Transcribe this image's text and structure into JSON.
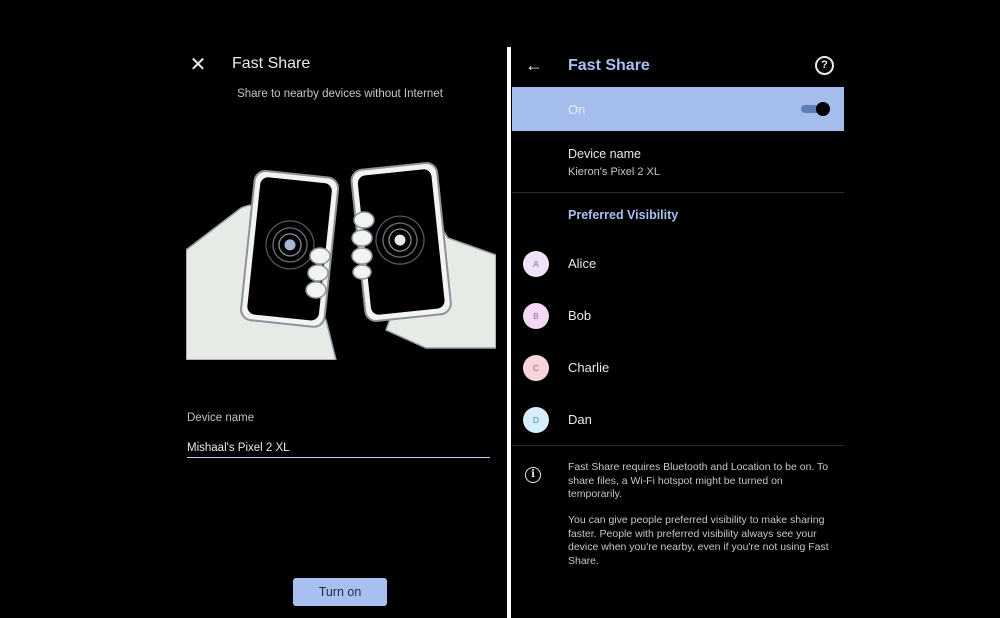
{
  "setup": {
    "title": "Fast Share",
    "subtitle": "Share to nearby devices without Internet",
    "device_name_label": "Device name",
    "device_name_value": "Mishaal's Pixel 2 XL",
    "turn_on_label": "Turn on",
    "close_icon": "close-icon"
  },
  "settings": {
    "title": "Fast Share",
    "on_label": "On",
    "toggle_on": true,
    "device_name_label": "Device name",
    "device_name_value": "Kieron's Pixel 2 XL",
    "preferred_header": "Preferred Visibility",
    "contacts": [
      {
        "initial": "A",
        "name": "Alice",
        "bg": "#efe3f7",
        "fg": "#8a6aa8"
      },
      {
        "initial": "B",
        "name": "Bob",
        "bg": "#f4d9f5",
        "fg": "#a060a8"
      },
      {
        "initial": "C",
        "name": "Charlie",
        "bg": "#f8d5dc",
        "fg": "#b05a70"
      },
      {
        "initial": "D",
        "name": "Dan",
        "bg": "#d6eefc",
        "fg": "#4a88b4"
      }
    ],
    "info_text_1": "Fast Share requires Bluetooth and Location to be on. To share files, a Wi-Fi hotspot might be turned on temporarily.",
    "info_text_2": "You can give people preferred visibility to make sharing faster. People with preferred visibility always see your device when you're nearby, even if you're not using Fast Share."
  },
  "colors": {
    "accent": "#a8c0f0",
    "on_row": "#a5bdec",
    "background": "#000000"
  }
}
